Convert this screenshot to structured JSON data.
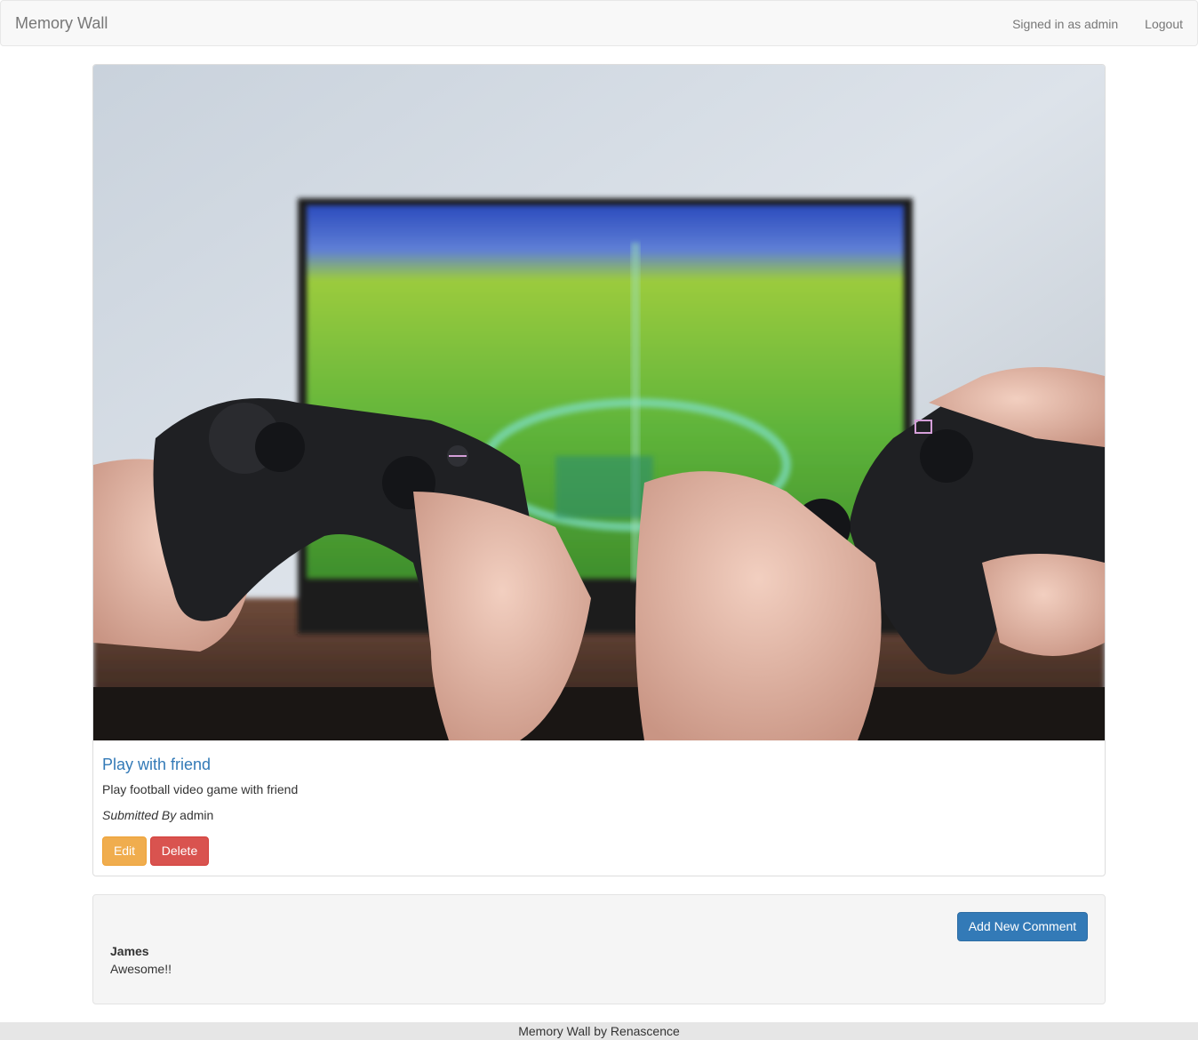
{
  "navbar": {
    "brand": "Memory Wall",
    "signed_in": "Signed in as admin",
    "logout": "Logout"
  },
  "memory": {
    "title": "Play with friend",
    "description": "Play football video game with friend",
    "submitted_by_label": "Submitted By",
    "submitted_by_user": "admin",
    "edit_label": "Edit",
    "delete_label": "Delete"
  },
  "comments": {
    "add_label": "Add New Comment",
    "items": [
      {
        "author": "James",
        "text": "Awesome!!"
      }
    ]
  },
  "footer": {
    "text": "Memory Wall by Renascence"
  },
  "colors": {
    "link": "#337ab7",
    "warning": "#f0ad4e",
    "danger": "#d9534f",
    "primary": "#337ab7"
  }
}
